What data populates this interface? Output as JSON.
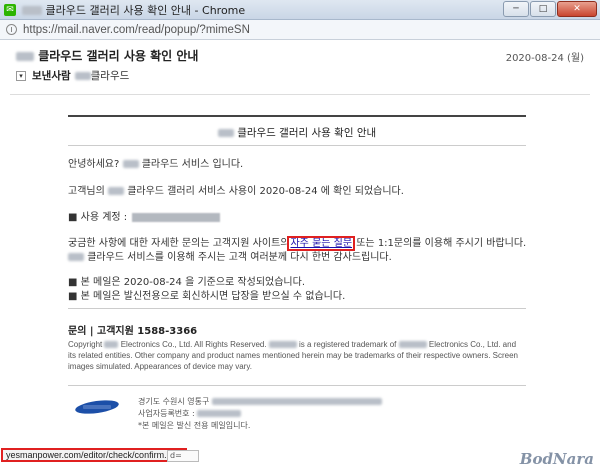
{
  "window": {
    "title": "클라우드 갤러리 사용 확인 안내 - Chrome",
    "url": "https://mail.naver.com/read/popup/?mimeSN",
    "minimize": "─",
    "maximize": "□",
    "close": "✕"
  },
  "mail": {
    "subject": "클라우드 갤러리 사용 확인 안내",
    "date": "2020-08-24 (월)",
    "sender_label": "보낸사람",
    "sender_name": "클라우드"
  },
  "body": {
    "title": "클라우드 갤러리 사용 확인 안내",
    "greeting_pre": "안녕하세요?",
    "greeting_post": "클라우드 서비스 입니다.",
    "usage_pre": "고객님의",
    "usage_post": "클라우드 갤러리 서비스 사용이 2020-08-24 에 확인 되었습니다.",
    "account_label": "■ 사용 계정 :",
    "inquiry_pre": "궁금한 사항에 대한 자세한 문의는 고객지원 사이트의",
    "faq_link": "자주 묻는 질문",
    "inquiry_post": "또는 1:1문의를 이용해 주시기 바랍니다.",
    "thanks_post": "클라우드 서비스를 이용해 주시는 고객 여러분께 다시 한번 감사드립니다.",
    "note1": "■ 본 메일은 2020-08-24 을 기준으로 작성되었습니다.",
    "note2": "■ 본 메일은 발신전용으로 회신하시면 답장을 받으실 수 없습니다.",
    "support": "문의 | 고객지원 1588-3366",
    "copyright_1": "Copyright",
    "copyright_2": "Electronics Co., Ltd. All Rights Reserved.",
    "copyright_3": "is a registered trademark of",
    "copyright_4": "Electronics Co., Ltd. and its related entities. Other company and product names mentioned herein may be trademarks of their respective owners. Screen images simulated. Appearances of device may vary.",
    "address_line": "경기도 수원시 영통구",
    "business_label": "사업자등록번호 :",
    "sender_only": "*본 메일은 발신 전용 메일입니다."
  },
  "status": {
    "url": "yesmanpower.com/editor/check/confirm.php",
    "tail": "d="
  },
  "watermark": "BodNara"
}
